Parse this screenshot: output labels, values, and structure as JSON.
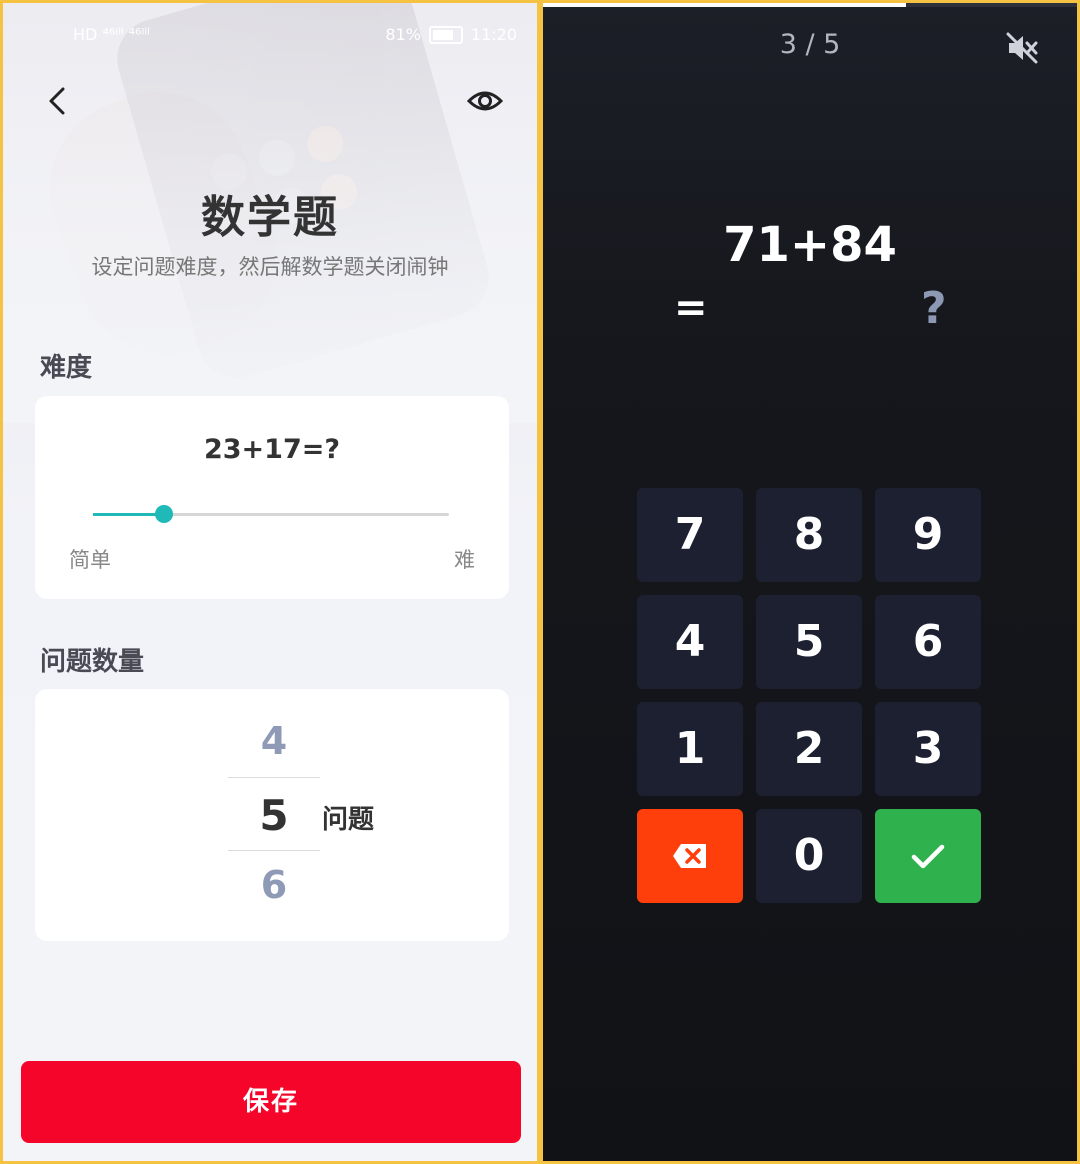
{
  "status_bar": {
    "left": "HD ⁴⁶ᴵˡˡ ⁴⁶ᴵˡˡ",
    "battery": "81%",
    "time": "11:20"
  },
  "settings": {
    "title": "数学题",
    "subtitle": "设定问题难度，然后解数学题关闭闹钟",
    "difficulty": {
      "label": "难度",
      "example": "23+17=?",
      "easy_label": "简单",
      "hard_label": "难",
      "level": 0.2
    },
    "count": {
      "label": "问题数量",
      "above": "4",
      "selected": "5",
      "below": "6",
      "unit": "问题"
    },
    "save_label": "保存"
  },
  "quiz": {
    "counter": "3 / 5",
    "progress": 0.68,
    "expression": "71+84",
    "equals": "=",
    "answer": "?",
    "keys": [
      "7",
      "8",
      "9",
      "4",
      "5",
      "6",
      "1",
      "2",
      "3",
      "⌫",
      "0",
      "✓"
    ]
  },
  "colors": {
    "accent_teal": "#1fb9b8",
    "save_red": "#f5052a",
    "delete_orange": "#fe3f0c",
    "confirm_green": "#2fb14e",
    "frame_yellow": "#f5c242"
  },
  "icons": [
    "back-arrow-icon",
    "eye-icon",
    "mute-icon",
    "backspace-icon",
    "check-icon"
  ]
}
